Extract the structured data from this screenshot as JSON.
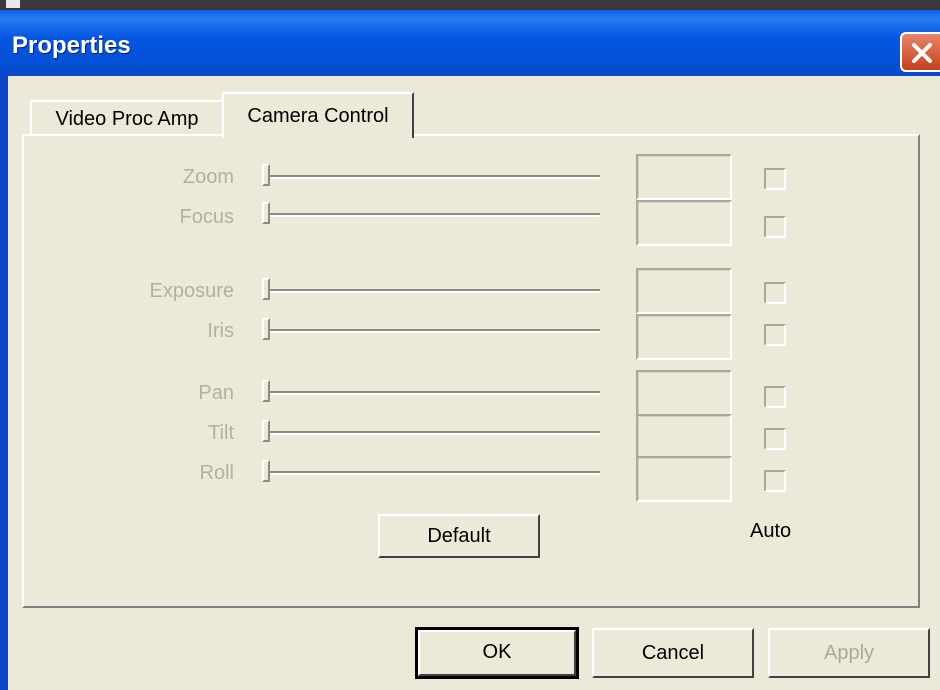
{
  "window": {
    "title": "Properties",
    "close_icon": "close-icon",
    "accent_color": "#0a5ee6",
    "close_color": "#c4401c"
  },
  "tabs": [
    {
      "label": "Video Proc Amp",
      "active": false
    },
    {
      "label": "Camera Control",
      "active": true
    }
  ],
  "controls": [
    {
      "label": "Zoom"
    },
    {
      "label": "Focus"
    },
    {
      "label": "Exposure"
    },
    {
      "label": "Iris"
    },
    {
      "label": "Pan"
    },
    {
      "label": "Tilt"
    },
    {
      "label": "Roll"
    }
  ],
  "default_button": "Default",
  "auto_label": "Auto",
  "buttons": {
    "ok": "OK",
    "cancel": "Cancel",
    "apply": "Apply"
  }
}
